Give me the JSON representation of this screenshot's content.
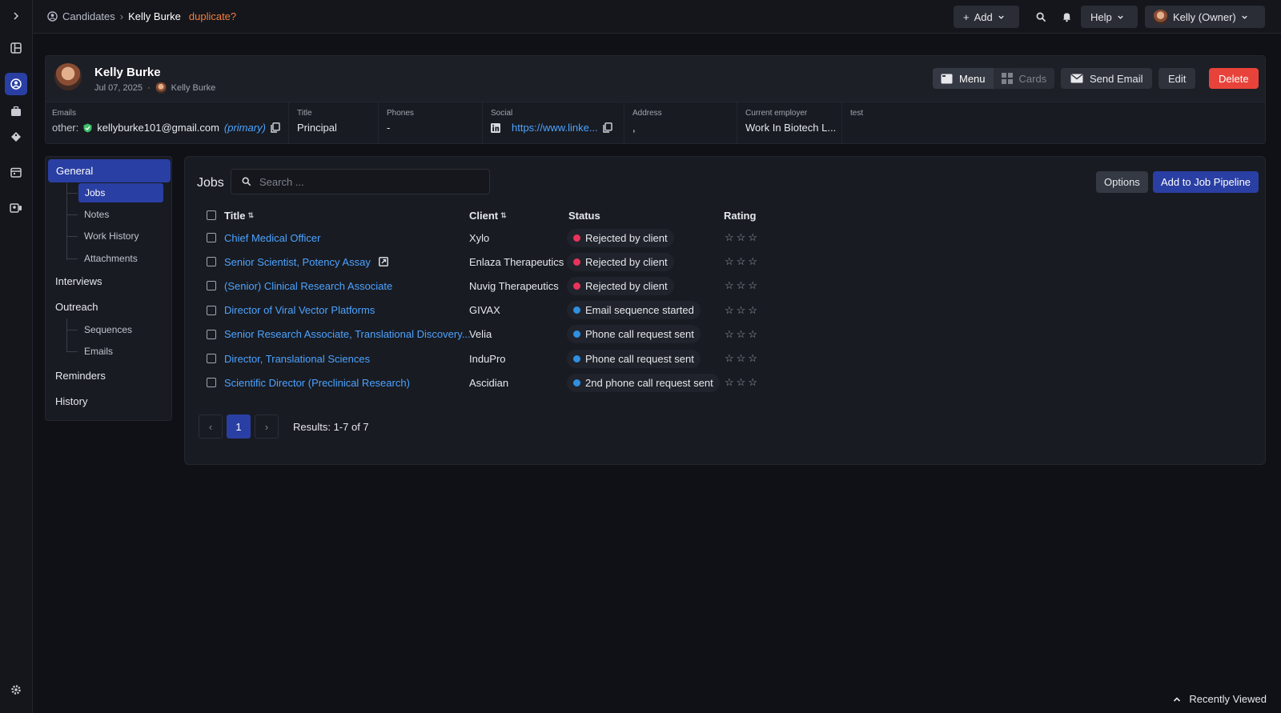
{
  "breadcrumb": {
    "section": "Candidates",
    "current": "Kelly Burke",
    "flag": "duplicate?"
  },
  "topbar": {
    "add_label": "Add",
    "help_label": "Help",
    "user_label": "Kelly (Owner)"
  },
  "profile": {
    "name": "Kelly Burke",
    "date": "Jul 07, 2025",
    "owner": "Kelly Burke",
    "actions": {
      "menu": "Menu",
      "cards": "Cards",
      "send_email": "Send Email",
      "edit": "Edit",
      "delete": "Delete"
    },
    "fields": {
      "emails_label": "Emails",
      "email_prefix": "other:",
      "email_value": "kellyburke101@gmail.com",
      "email_tag": "(primary)",
      "title_label": "Title",
      "title_value": "Principal",
      "phones_label": "Phones",
      "phones_value": "-",
      "social_label": "Social",
      "social_value": "https://www.linke...",
      "address_label": "Address",
      "address_value": ",",
      "employer_label": "Current employer",
      "employer_value": "Work In Biotech L...",
      "test_label": "test"
    }
  },
  "subnav": {
    "general": "General",
    "jobs": "Jobs",
    "notes": "Notes",
    "work_history": "Work History",
    "attachments": "Attachments",
    "interviews": "Interviews",
    "outreach": "Outreach",
    "sequences": "Sequences",
    "emails": "Emails",
    "reminders": "Reminders",
    "history": "History"
  },
  "jobs": {
    "title": "Jobs",
    "search_placeholder": "Search ...",
    "options_label": "Options",
    "add_pipeline_label": "Add to Job Pipeline",
    "columns": {
      "title": "Title",
      "client": "Client",
      "status": "Status",
      "rating": "Rating"
    },
    "rows": [
      {
        "title": "Chief Medical Officer",
        "client": "Xylo",
        "status": "Rejected by client",
        "status_color": "#e8345a",
        "rating": 0
      },
      {
        "title": "Senior Scientist, Potency Assay",
        "client": "Enlaza Therapeutics",
        "status": "Rejected by client",
        "status_color": "#e8345a",
        "rating": 0
      },
      {
        "title": "(Senior) Clinical Research Associate",
        "client": "Nuvig Therapeutics",
        "status": "Rejected by client",
        "status_color": "#e8345a",
        "rating": 0
      },
      {
        "title": "Director of Viral Vector Platforms",
        "client": "GIVAX",
        "status": "Email sequence started",
        "status_color": "#2f8fe0",
        "rating": 0
      },
      {
        "title": "Senior Research Associate, Translational Discovery...",
        "client": "Velia",
        "status": "Phone call request sent",
        "status_color": "#2f8fe0",
        "rating": 0
      },
      {
        "title": "Director, Translational Sciences",
        "client": "InduPro",
        "status": "Phone call request sent",
        "status_color": "#2f8fe0",
        "rating": 0
      },
      {
        "title": "Scientific Director (Preclinical Research)",
        "client": "Ascidian",
        "status": "2nd phone call request sent",
        "status_color": "#2f8fe0",
        "rating": 0
      }
    ],
    "pagination": {
      "current_page": "1",
      "results": "Results: 1-7 of 7"
    }
  },
  "footer": {
    "recently_viewed": "Recently Viewed"
  },
  "colors": {
    "accent": "#2a3fa3",
    "link": "#4da3ff",
    "danger": "#e8433a",
    "warning": "#f57d3b"
  }
}
